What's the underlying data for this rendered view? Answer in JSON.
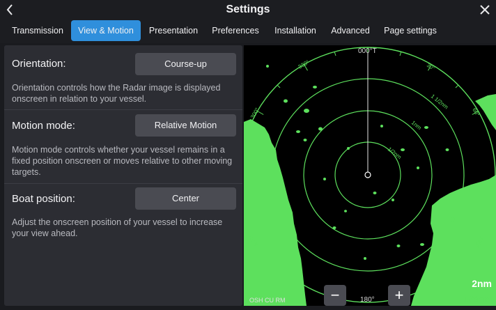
{
  "header": {
    "title": "Settings",
    "back_icon": "chevron-left-icon",
    "close_icon": "close-icon"
  },
  "tabs": [
    {
      "label": "Transmission",
      "active": false
    },
    {
      "label": "View & Motion",
      "active": true
    },
    {
      "label": "Presentation",
      "active": false
    },
    {
      "label": "Preferences",
      "active": false
    },
    {
      "label": "Installation",
      "active": false
    },
    {
      "label": "Advanced",
      "active": false
    },
    {
      "label": "Page settings",
      "active": false
    }
  ],
  "settings": {
    "orientation": {
      "label": "Orientation:",
      "value": "Course-up",
      "description": "Orientation controls how the Radar image is displayed onscreen in relation to your vessel."
    },
    "motion_mode": {
      "label": "Motion mode:",
      "value": "Relative Motion",
      "description": "Motion mode controls whether your vessel remains in a fixed position onscreen or moves relative to other moving targets."
    },
    "boat_position": {
      "label": "Boat position:",
      "value": "Center",
      "description": "Adjust the onscreen position of your vessel to increase your view ahead."
    }
  },
  "radar": {
    "heading": "000°T",
    "bottom_bearing": "180°",
    "status": "OSH CU RM",
    "range": "2nm",
    "ring_spacing": "1/2nm",
    "ring_labels": [
      "1/2nm",
      "1nm",
      "1 1/2nm"
    ],
    "bearing_labels": [
      "330°",
      "30°",
      "300°",
      "60°",
      "240°",
      "120°"
    ],
    "zoom_out_label": "−",
    "zoom_in_label": "+",
    "accent_color": "#5de05d"
  },
  "colors": {
    "active_tab": "#2f8fdc",
    "panel_bg": "#2c2d33",
    "button_bg": "#4a4b52",
    "radar_green": "#5de05d"
  }
}
